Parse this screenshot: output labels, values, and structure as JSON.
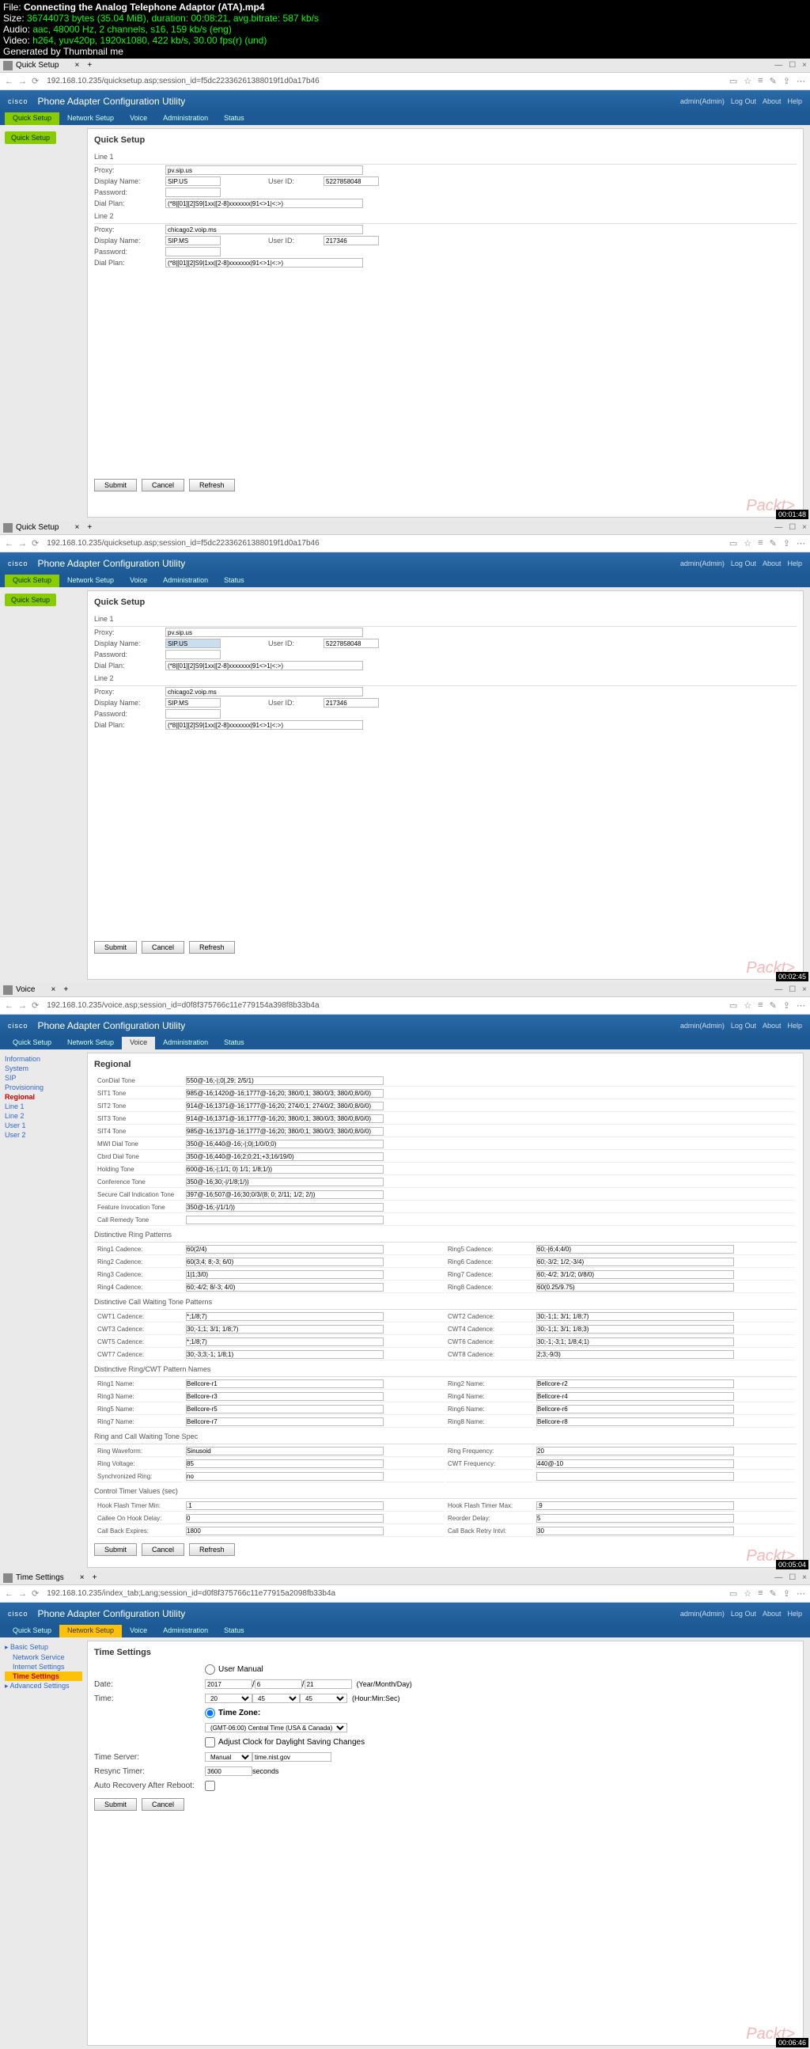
{
  "meta": {
    "file": "Connecting the Analog Telephone Adaptor (ATA).mp4",
    "size": "36744073 bytes (35.04 MiB), duration: 00:08:21, avg.bitrate: 587 kb/s",
    "audio": "aac, 48000 Hz, 2 channels, s16, 159 kb/s (eng)",
    "video": "h264, yuv420p, 1920x1080, 422 kb/s, 30.00 fps(r) (und)",
    "gen": "Generated by Thumbnail me"
  },
  "hdr": {
    "title": "Phone Adapter Configuration Utility",
    "logo": "cisco",
    "links": [
      "admin(Admin)",
      "Log Out",
      "About",
      "Help"
    ]
  },
  "nav": {
    "tabs": [
      "Quick Setup",
      "Network Setup",
      "Voice",
      "Administration",
      "Status"
    ]
  },
  "s1": {
    "tabtitle": "Quick Setup",
    "url": "192.168.10.235/quicksetup.asp;session_id=f5dc22336261388019f1d0a17b46",
    "ts": "00:01:48",
    "h": "Quick Setup",
    "line1": "Line 1",
    "line2": "Line 2",
    "labels": {
      "proxy": "Proxy:",
      "dname": "Display Name:",
      "pwd": "Password:",
      "dplan": "Dial Plan:",
      "uid": "User ID:"
    },
    "v": {
      "proxy1": "pv.sip.us",
      "dname1": "SIP.US",
      "pwd1": "",
      "dplan1": "(*8|[01][2]S9|1xx|[2-8]xxxxxxx|91<>1|<:>)",
      "uid1": "5227858048",
      "proxy2": "chicago2.voip.ms",
      "dname2": "SIP.MS",
      "pwd2": "",
      "dplan2": "(*8|[01][2]S9|1xx|[2-8]xxxxxxx|91<>1|<:>)",
      "uid2": "217346"
    },
    "btns": [
      "Submit",
      "Cancel",
      "Refresh"
    ]
  },
  "s2": {
    "tabtitle": "Quick Setup",
    "url": "192.168.10.235/quicksetup.asp;session_id=f5dc22336261388019f1d0a17b46",
    "ts": "00:02:45",
    "h": "Quick Setup",
    "v": {
      "proxy1": "pv.sip.us",
      "dname1": "SIP.US",
      "pwd1": "",
      "dplan1": "(*8|[01][2]S9|1xx|[2-8]xxxxxxx|91<>1|<:>)",
      "uid1": "5227858048",
      "proxy2": "chicago2.voip.ms",
      "dname2": "SIP.MS",
      "pwd2": "",
      "dplan2": "(*8|[01][2]S9|1xx|[2-8]xxxxxxx|91<>1|<:>)",
      "uid2": "217346"
    }
  },
  "s3": {
    "tabtitle": "Voice",
    "url": "192.168.10.235/voice.asp;session_id=d0f8f375766c11e779154a398f8b33b4a",
    "ts": "00:05:04",
    "h": "Regional",
    "sidebar": [
      "Information",
      "System",
      "SIP",
      "Provisioning",
      "Regional",
      "Line 1",
      "Line 2",
      "User 1",
      "User 2"
    ],
    "rows": [
      [
        "ConDial Tone",
        "550@-16;-|;0|,29; 2/5/1)"
      ],
      [
        "SIT1 Tone",
        "985@-16;1420@-16;1777@-16;20; 380/0;1; 380/0/3; 380/0;8/0/0)"
      ],
      [
        "SIT2 Tone",
        "914@-16;1371@-16;1777@-16;20; 274/0;1; 274/0/2; 380/0;8/0/0)"
      ],
      [
        "SIT3 Tone",
        "914@-16;1371@-16;1777@-16;20; 380/0;1; 380/0/3; 380/0;8/0/0)"
      ],
      [
        "SIT4 Tone",
        "985@-16;1371@-16;1777@-16;20; 380/0;1; 380/0/3; 380/0;8/0/0)"
      ],
      [
        "MWI Dial Tone",
        "350@-16;440@-16;-|;0|;1/0/0;0)"
      ],
      [
        "Cbrd Dial Tone",
        "350@-16;440@-16;2;0;21;+3;16/19/0)"
      ],
      [
        "Holding Tone",
        "600@-16;-|;1/1; 0) 1/1; 1/8;1/))"
      ],
      [
        "Conference Tone",
        "350@-16;30;-|/1/8;1/))"
      ],
      [
        "Secure Call Indication Tone",
        "397@-16;507@-16;30;0/3/(8; 0; 2/11; 1/2; 2/))"
      ],
      [
        "Feature Invocation Tone",
        "350@-16;-|/1/1/))"
      ],
      [
        "Call Remedy Tone",
        ""
      ]
    ],
    "sec2": "Distinctive Ring Patterns",
    "ring": [
      [
        "Ring1 Cadence:",
        "60(2/4)",
        "Ring5 Cadence:",
        "60;-|6;4;4/0)"
      ],
      [
        "Ring2 Cadence:",
        "60(3;4; 8;-3; 6/0)",
        "Ring6 Cadence:",
        "60;-3/2; 1/2;-3/4)"
      ],
      [
        "Ring3 Cadence:",
        "1|1;3/0)",
        "Ring7 Cadence:",
        "60;-4/2; 3/1/2; 0/8/0)"
      ],
      [
        "Ring4 Cadence:",
        "60;-4/2; 8/-3; 4/0)",
        "Ring8 Cadence:",
        "60(0.25/9.75)"
      ]
    ],
    "sec3": "Distinctive Call Waiting Tone Patterns",
    "cwt": [
      [
        "CWT1 Cadence:",
        "*;1/8;7)",
        "CWT2 Cadence:",
        "30;-1;1; 3/1; 1/8;7)"
      ],
      [
        "CWT3 Cadence:",
        "30;-1;1; 3/1; 1/8;7)",
        "CWT4 Cadence:",
        "30;-1;1; 3/1; 1/8;3)"
      ],
      [
        "CWT5 Cadence:",
        "*;1/8;7)",
        "CWT6 Cadence:",
        "30;-1;-3;1; 1/8;4;1)"
      ],
      [
        "CWT7 Cadence:",
        "30;-3;3;-1; 1/8;1)",
        "CWT8 Cadence:",
        "2;3;-9/3)"
      ]
    ],
    "sec4": "Distinctive Ring/CWT Pattern Names",
    "names": [
      [
        "Ring1 Name:",
        "Bellcore-r1",
        "Ring2 Name:",
        "Bellcore-r2"
      ],
      [
        "Ring3 Name:",
        "Bellcore-r3",
        "Ring4 Name:",
        "Bellcore-r4"
      ],
      [
        "Ring5 Name:",
        "Bellcore-r5",
        "Ring6 Name:",
        "Bellcore-r6"
      ],
      [
        "Ring7 Name:",
        "Bellcore-r7",
        "Ring8 Name:",
        "Bellcore-r8"
      ]
    ],
    "sec5": "Ring and Call Waiting Tone Spec",
    "spec": [
      [
        "Ring Waveform:",
        "Sinusoid",
        "Ring Frequency:",
        "20"
      ],
      [
        "Ring Voltage:",
        "85",
        "CWT Frequency:",
        "440@-10"
      ],
      [
        "Synchronized Ring:",
        "no",
        "",
        ""
      ]
    ],
    "sec6": "Control Timer Values (sec)",
    "ctrl": [
      [
        "Hook Flash Timer Min:",
        ".1",
        "Hook Flash Timer Max:",
        ".9"
      ],
      [
        "Callee On Hook Delay:",
        "0",
        "Reorder Delay:",
        "5"
      ],
      [
        "Call Back Expires:",
        "1800",
        "Call Back Retry Intvl:",
        "30"
      ]
    ]
  },
  "s4": {
    "tabtitle": "Time Settings",
    "url": "192.168.10.235/index_tab;Lang;session_id=d0f8f375766c11e77915a2098fb33b4a",
    "ts": "00:06:46",
    "h": "Time Settings",
    "sidebar": [
      "Basic Setup",
      "Network Service",
      "Internet Settings",
      "Time Settings",
      "Advanced Settings"
    ],
    "um": "User Manual",
    "date": "Date:",
    "time": "Time:",
    "tz": "Time Zone:",
    "ac": "Adjust Clock for Daylight Saving Changes",
    "tserver": "Time Server:",
    "resync": "Resync Timer:",
    "auto": "Auto Recovery After Reboot:",
    "datev": [
      "2017",
      "/",
      "6",
      "/",
      "21",
      "(Year/Month/Day)"
    ],
    "timev": [
      "20",
      "45",
      "45",
      "(Hour:Min:Sec)"
    ],
    "tzv": "(GMT-06:00) Central Time (USA & Canada)",
    "tservv": [
      "Manual",
      "time.nist.gov"
    ],
    "resyncv": [
      "3600",
      "seconds"
    ],
    "btns": [
      "Submit",
      "Cancel"
    ]
  },
  "wm": "Packt>"
}
